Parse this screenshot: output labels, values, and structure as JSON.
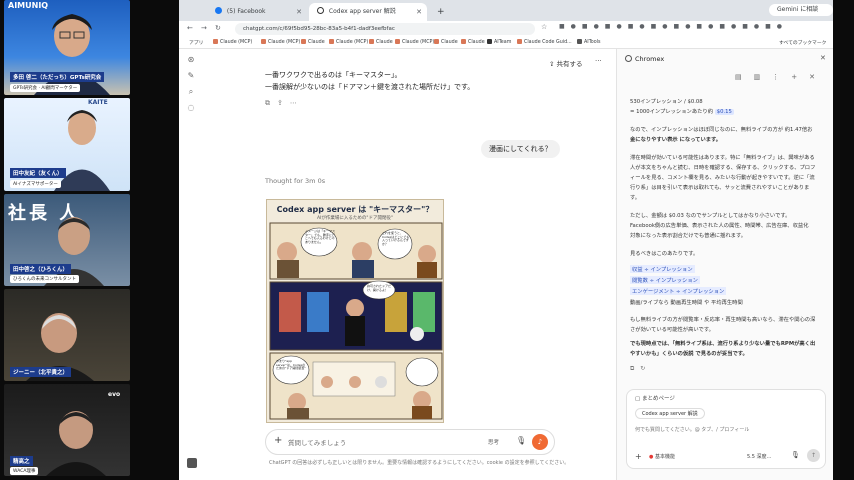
{
  "participants": [
    {
      "name": "多田 啓二（ただっち）GPTs研究会",
      "sub": "GPTs研究会 · AI顧問マーケター",
      "banner": "AIMUNIQ"
    },
    {
      "name": "田中友紀（友くん）",
      "sub": "AIイナズマサポーター",
      "banner": "KAITE"
    },
    {
      "name": "田中啓之（ひろくん）",
      "sub": "ひろくんの未来コンサルタント",
      "banner": "社長 人"
    },
    {
      "name": "ジーニー（北平貴之）",
      "sub": "",
      "banner": ""
    },
    {
      "name": "精高之",
      "sub": "WACA理事",
      "banner": "evo"
    }
  ],
  "browser": {
    "tabs": [
      {
        "label": "(5) Facebook"
      },
      {
        "label": "Codex app server 解説"
      }
    ],
    "profile_label": "Gemini に相談",
    "url": "chatgpt.com/c/69f5bd95-28bc-83a5-b4f1-dadf3eefbfac",
    "bookmarks": [
      "アプリ",
      "Claude (MCP)",
      "Claude (MCP)",
      "Claude",
      "Claude (MCP)",
      "Claude",
      "Claude (MCP)",
      "Claude",
      "Claude",
      "AITeam",
      "Claude Code Guid...",
      "AITools"
    ],
    "all_bookmarks": "すべてのブックマーク"
  },
  "chat": {
    "share_label": "共有する",
    "line1": "一番ワクワクで出るのは「キーマスター」。",
    "line2": "一番誤解が少ないのは「ドアマン＋鍵を渡された場所だけ」です。",
    "user_msg": "漫画にしてくれる？",
    "thought": "Thought for 3m 0s",
    "comic_title": "Codex app server は \"キーマスター\"？",
    "comic_subtitle": "AIが作業場に入るための\"ドア開閉役\"",
    "comic_bubble1": "イメージは「キーマスター」でも、勝手にどこへでも入るわけじゃありません。",
    "comic_bubble2": "これを使うと、Codexはどこにでも入っていけるんですか？",
    "comic_bubble3": "許可されたドアだけ、開けるよ！",
    "comic_bubble4": "つまり\"app server\"は、Codexのための\"ドア開閉装置\"",
    "placeholder": "質問してみましょう",
    "model_label": "思考",
    "disclaimer": "ChatGPT の回答は必ずしも正しいとは限りません。重要な情報は確認するようにしてください。cookie の設定を参照してください。"
  },
  "panel": {
    "title": "Chromex",
    "lines": [
      "530インプレッション / $0.08",
      "= 1000インプレッションあたり約 $0.15",
      "なので、インプレッションはほぼ同じなのに、無料ライブの方が 約1.47倍お",
      "金になりやすい表示 になっています。",
      "滞在時間が効いている可能性はあります。特に「無料ライブ」は、興味がある",
      "人が本文をちゃんと読む、日時を確認する、保存する、クリックする、プロフ",
      "ィールを見る、コメント欄を見る、みたいな行動が起きやすいです。逆に「流",
      "行り系」は目を引いて表示は取れても、サッと流費されやすいことがありま",
      "す。",
      "ただし、金額は $0.03 なのでサンプルとしてはかなり小さいです。",
      "Facebook側の広告単価、表示された人の属性、時間帯、広告在庫、収益化",
      "対象になった表示割合だけでも普通に揺れます。",
      "見るべきはこのあたりです。",
      "収益 ÷ インプレッション",
      "閲覧数 ÷ インプレッション",
      "エンゲージメント ÷ インプレッション",
      "動画/ライブなら 動画再生時間 や 平均再生時間",
      "もし無料ライブの方が閲覧率・反応率・再生時間も高いなら、滞在や関心の深",
      "さが効いている可能性が高いです。",
      "でも現時点では、「無料ライブ系は、流行り系より少ない量でもRPMが高く出",
      "やすいかも」くらいの仮説 で見るのが妥当です。"
    ],
    "summary_label": "まとめページ",
    "context_tab": "Codex app server 解説",
    "input_placeholder": "何でも質問してください。@ タブ、/ プロフィール",
    "bottom_mode": "基本機能",
    "bottom_model": "5.5 深度…"
  },
  "colors": {
    "accent_orange": "#f06a34",
    "link_blue": "#2b4fb9"
  }
}
